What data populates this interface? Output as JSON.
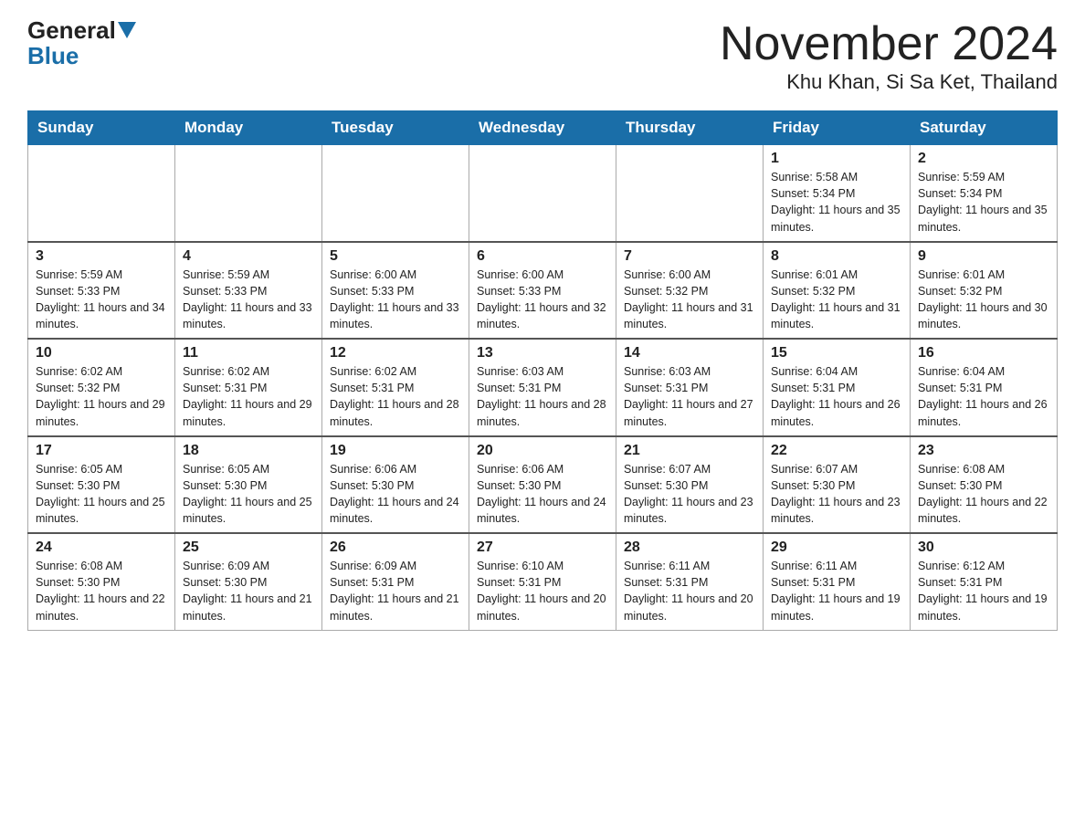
{
  "logo": {
    "general": "General",
    "blue": "Blue"
  },
  "title": "November 2024",
  "location": "Khu Khan, Si Sa Ket, Thailand",
  "days_of_week": [
    "Sunday",
    "Monday",
    "Tuesday",
    "Wednesday",
    "Thursday",
    "Friday",
    "Saturday"
  ],
  "weeks": [
    [
      {
        "day": "",
        "info": ""
      },
      {
        "day": "",
        "info": ""
      },
      {
        "day": "",
        "info": ""
      },
      {
        "day": "",
        "info": ""
      },
      {
        "day": "",
        "info": ""
      },
      {
        "day": "1",
        "info": "Sunrise: 5:58 AM\nSunset: 5:34 PM\nDaylight: 11 hours and 35 minutes."
      },
      {
        "day": "2",
        "info": "Sunrise: 5:59 AM\nSunset: 5:34 PM\nDaylight: 11 hours and 35 minutes."
      }
    ],
    [
      {
        "day": "3",
        "info": "Sunrise: 5:59 AM\nSunset: 5:33 PM\nDaylight: 11 hours and 34 minutes."
      },
      {
        "day": "4",
        "info": "Sunrise: 5:59 AM\nSunset: 5:33 PM\nDaylight: 11 hours and 33 minutes."
      },
      {
        "day": "5",
        "info": "Sunrise: 6:00 AM\nSunset: 5:33 PM\nDaylight: 11 hours and 33 minutes."
      },
      {
        "day": "6",
        "info": "Sunrise: 6:00 AM\nSunset: 5:33 PM\nDaylight: 11 hours and 32 minutes."
      },
      {
        "day": "7",
        "info": "Sunrise: 6:00 AM\nSunset: 5:32 PM\nDaylight: 11 hours and 31 minutes."
      },
      {
        "day": "8",
        "info": "Sunrise: 6:01 AM\nSunset: 5:32 PM\nDaylight: 11 hours and 31 minutes."
      },
      {
        "day": "9",
        "info": "Sunrise: 6:01 AM\nSunset: 5:32 PM\nDaylight: 11 hours and 30 minutes."
      }
    ],
    [
      {
        "day": "10",
        "info": "Sunrise: 6:02 AM\nSunset: 5:32 PM\nDaylight: 11 hours and 29 minutes."
      },
      {
        "day": "11",
        "info": "Sunrise: 6:02 AM\nSunset: 5:31 PM\nDaylight: 11 hours and 29 minutes."
      },
      {
        "day": "12",
        "info": "Sunrise: 6:02 AM\nSunset: 5:31 PM\nDaylight: 11 hours and 28 minutes."
      },
      {
        "day": "13",
        "info": "Sunrise: 6:03 AM\nSunset: 5:31 PM\nDaylight: 11 hours and 28 minutes."
      },
      {
        "day": "14",
        "info": "Sunrise: 6:03 AM\nSunset: 5:31 PM\nDaylight: 11 hours and 27 minutes."
      },
      {
        "day": "15",
        "info": "Sunrise: 6:04 AM\nSunset: 5:31 PM\nDaylight: 11 hours and 26 minutes."
      },
      {
        "day": "16",
        "info": "Sunrise: 6:04 AM\nSunset: 5:31 PM\nDaylight: 11 hours and 26 minutes."
      }
    ],
    [
      {
        "day": "17",
        "info": "Sunrise: 6:05 AM\nSunset: 5:30 PM\nDaylight: 11 hours and 25 minutes."
      },
      {
        "day": "18",
        "info": "Sunrise: 6:05 AM\nSunset: 5:30 PM\nDaylight: 11 hours and 25 minutes."
      },
      {
        "day": "19",
        "info": "Sunrise: 6:06 AM\nSunset: 5:30 PM\nDaylight: 11 hours and 24 minutes."
      },
      {
        "day": "20",
        "info": "Sunrise: 6:06 AM\nSunset: 5:30 PM\nDaylight: 11 hours and 24 minutes."
      },
      {
        "day": "21",
        "info": "Sunrise: 6:07 AM\nSunset: 5:30 PM\nDaylight: 11 hours and 23 minutes."
      },
      {
        "day": "22",
        "info": "Sunrise: 6:07 AM\nSunset: 5:30 PM\nDaylight: 11 hours and 23 minutes."
      },
      {
        "day": "23",
        "info": "Sunrise: 6:08 AM\nSunset: 5:30 PM\nDaylight: 11 hours and 22 minutes."
      }
    ],
    [
      {
        "day": "24",
        "info": "Sunrise: 6:08 AM\nSunset: 5:30 PM\nDaylight: 11 hours and 22 minutes."
      },
      {
        "day": "25",
        "info": "Sunrise: 6:09 AM\nSunset: 5:30 PM\nDaylight: 11 hours and 21 minutes."
      },
      {
        "day": "26",
        "info": "Sunrise: 6:09 AM\nSunset: 5:31 PM\nDaylight: 11 hours and 21 minutes."
      },
      {
        "day": "27",
        "info": "Sunrise: 6:10 AM\nSunset: 5:31 PM\nDaylight: 11 hours and 20 minutes."
      },
      {
        "day": "28",
        "info": "Sunrise: 6:11 AM\nSunset: 5:31 PM\nDaylight: 11 hours and 20 minutes."
      },
      {
        "day": "29",
        "info": "Sunrise: 6:11 AM\nSunset: 5:31 PM\nDaylight: 11 hours and 19 minutes."
      },
      {
        "day": "30",
        "info": "Sunrise: 6:12 AM\nSunset: 5:31 PM\nDaylight: 11 hours and 19 minutes."
      }
    ]
  ]
}
